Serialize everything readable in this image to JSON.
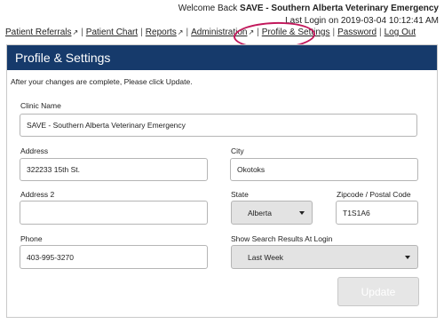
{
  "header": {
    "welcome_prefix": "Welcome Back ",
    "welcome_user": "SAVE - Southern Alberta Veterinary Emergency",
    "last_login": "Last Login on 2019-03-04 10:12:41 AM"
  },
  "nav": {
    "items": [
      {
        "label": "Patient Referrals",
        "external": true
      },
      {
        "label": "Patient Chart",
        "external": false
      },
      {
        "label": "Reports",
        "external": true
      },
      {
        "label": "Administration",
        "external": true
      },
      {
        "label": "Profile & Settings",
        "external": false
      },
      {
        "label": "Password",
        "external": false
      },
      {
        "label": "Log Out",
        "external": false
      }
    ],
    "separator": "|",
    "external_icon": "external-link-icon"
  },
  "panel": {
    "title": "Profile & Settings",
    "instructions": "After your changes are complete, Please click Update."
  },
  "form": {
    "clinic_name": {
      "label": "Clinic Name",
      "value": "SAVE - Southern Alberta Veterinary Emergency"
    },
    "address": {
      "label": "Address",
      "value": "322233 15th St."
    },
    "city": {
      "label": "City",
      "value": "Okotoks"
    },
    "address2": {
      "label": "Address 2",
      "value": ""
    },
    "state": {
      "label": "State",
      "value": "Alberta"
    },
    "zipcode": {
      "label": "Zipcode / Postal Code",
      "value": "T1S1A6"
    },
    "phone": {
      "label": "Phone",
      "value": "403-995-3270"
    },
    "search_results": {
      "label": "Show Search Results At Login",
      "value": "Last Week"
    }
  },
  "actions": {
    "update_label": "Update"
  },
  "colors": {
    "header_bg": "#163a6b",
    "highlight": "#c2185b",
    "button_disabled": "#e6e6e6"
  }
}
